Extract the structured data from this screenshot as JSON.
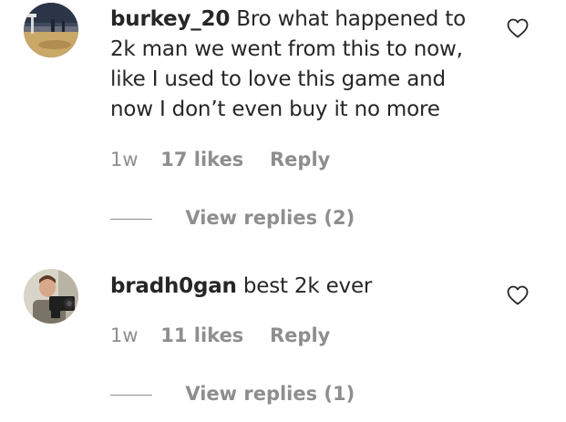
{
  "comments": [
    {
      "username": "burkey_20",
      "text": "Bro what happened to 2k man we went from this to now, like I used to love this game and now I don’t even buy it no more",
      "time": "1w",
      "likes": "17 likes",
      "reply": "Reply",
      "view_replies": "View replies (2)",
      "avatar_icon": "basketball-court-photo"
    },
    {
      "username": "bradh0gan",
      "text": "best 2k ever",
      "time": "1w",
      "likes": "11 likes",
      "reply": "Reply",
      "view_replies": "View replies (1)",
      "avatar_icon": "person-with-camera-photo"
    }
  ],
  "icons": {
    "like": "heart-outline-icon"
  },
  "colors": {
    "text": "#262626",
    "secondary": "#8e8e8e",
    "background": "#ffffff"
  }
}
